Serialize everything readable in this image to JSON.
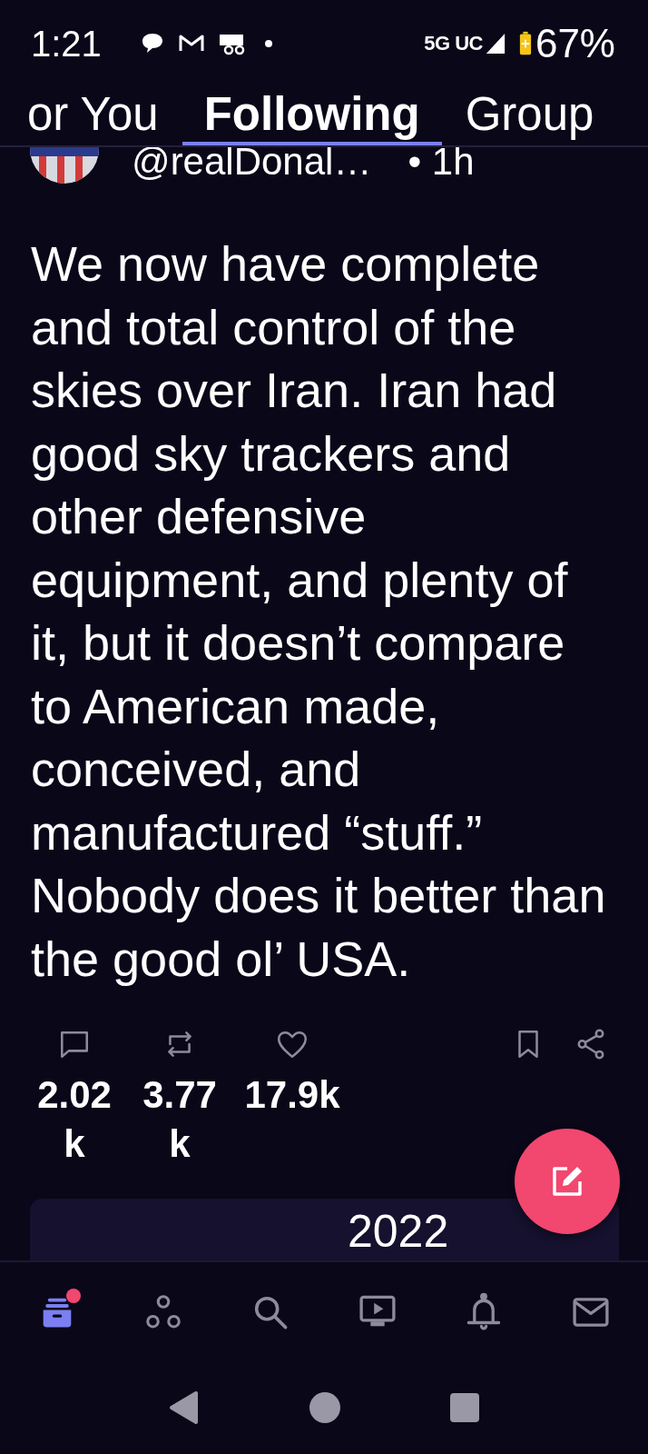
{
  "status_bar": {
    "time": "1:21",
    "network": "5G UC",
    "battery": "67%"
  },
  "tabs": [
    {
      "label": "or You",
      "selected": false
    },
    {
      "label": "Following",
      "selected": true
    },
    {
      "label": "Group",
      "selected": false
    }
  ],
  "post": {
    "handle": "@realDonal…",
    "time": "• 1h",
    "text": "We now have complete and total control of the skies over Iran. Iran had good sky trackers and other defensive equipment, and plenty of it, but it doesn’t compare to American made, conceived, and manufactured “stuff.” Nobody does it better than the good ol’ USA.",
    "actions": [
      {
        "kind": "reply",
        "count": "2.02k"
      },
      {
        "kind": "repost",
        "count": "3.77k"
      },
      {
        "kind": "like",
        "count": "17.9k"
      },
      {
        "kind": "bookmark"
      },
      {
        "kind": "share"
      }
    ]
  },
  "next_card": {
    "text": "2022"
  },
  "bottom_nav": [
    {
      "kind": "home",
      "selected": true,
      "badge": true
    },
    {
      "kind": "groups",
      "selected": false,
      "badge": false
    },
    {
      "kind": "search",
      "selected": false,
      "badge": false
    },
    {
      "kind": "video",
      "selected": false,
      "badge": false
    },
    {
      "kind": "bell",
      "selected": false,
      "badge": false
    },
    {
      "kind": "mail",
      "selected": false,
      "badge": false
    }
  ]
}
